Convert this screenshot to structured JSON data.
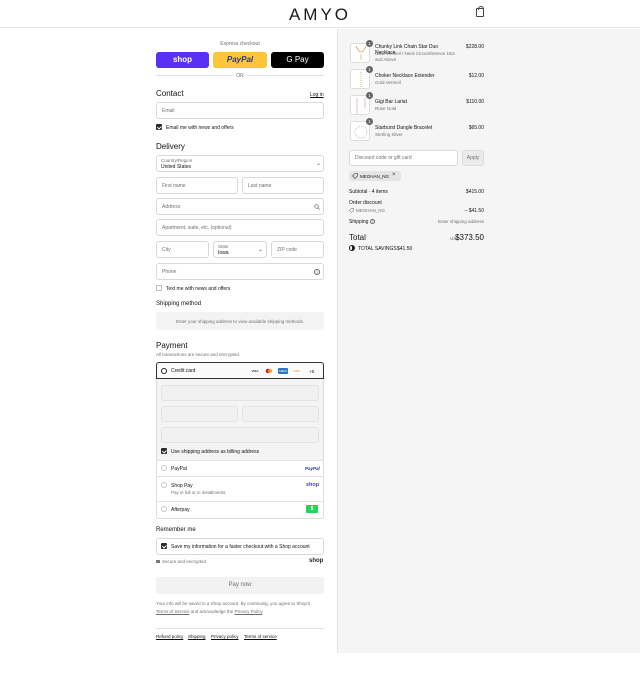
{
  "header": {
    "brand": "AMYO",
    "cart_icon": "shopping-bag-icon"
  },
  "express": {
    "heading": "Express checkout",
    "shop_label": "shop",
    "paypal_label": "PayPal",
    "gpay_label": "G Pay",
    "or_label": "OR",
    "colors": {
      "shop": "#5a31f4",
      "paypal": "#ffc439",
      "gpay": "#000000"
    }
  },
  "contact": {
    "title": "Contact",
    "login_link": "Log in",
    "email_placeholder": "Email",
    "newsletter_label": "Email me with news and offers"
  },
  "delivery": {
    "title": "Delivery",
    "country_label": "Country/Region",
    "country_value": "United States",
    "first_name_placeholder": "First name",
    "last_name_placeholder": "Last name",
    "address_placeholder": "Address",
    "apartment_placeholder": "Apartment, suite, etc. (optional)",
    "city_placeholder": "City",
    "state_label": "State",
    "state_value": "Iowa",
    "zip_placeholder": "ZIP code",
    "phone_placeholder": "Phone",
    "text_offers_label": "Text me with news and offers"
  },
  "shipping_method": {
    "title": "Shipping method",
    "notice": "Enter your shipping address to view available shipping methods."
  },
  "payment": {
    "title": "Payment",
    "subtitle": "All transactions are secure and encrypted.",
    "credit_card_label": "Credit card",
    "card_badges": [
      "VISA",
      "MC",
      "AMEX",
      "DISC"
    ],
    "more_cards": "+5",
    "billing_label": "Use shipping address as billing address",
    "paypal_label": "PayPal",
    "paypal_logo": "PayPal",
    "shoppay_label": "Shop Pay",
    "shoppay_sub": "Pay in full or in installments",
    "shoppay_logo": "shop",
    "afterpay_label": "Afterpay",
    "afterpay_logo": "$"
  },
  "remember": {
    "title": "Remember me",
    "save_label": "Save my information for a faster checkout with a Shop account",
    "secure_label": "Secure and encrypted",
    "shop_logo": "shop"
  },
  "pay_now": "Pay now",
  "legal": {
    "line1": "Your info will be saved to a Shop account. By continuing, you agree to Shop's",
    "tos": "Terms of Service",
    "and": "and acknowledge the",
    "privacy": "Privacy Policy",
    "period": "."
  },
  "footer_links": [
    "Refund policy",
    "Shipping",
    "Privacy policy",
    "Terms of service"
  ],
  "order": {
    "items": [
      {
        "qty": "1",
        "name": "Chunky Link Chain Star Duo Necklace",
        "variant": "Gold Vermeil / Neck Circumference 15in and Above",
        "price": "$228.00"
      },
      {
        "qty": "1",
        "name": "Choker Necklace Extender",
        "variant": "Gold Vermeil",
        "price": "$12.00"
      },
      {
        "qty": "1",
        "name": "Gigi Bar Lariat",
        "variant": "Rose Gold",
        "price": "$110.00"
      },
      {
        "qty": "1",
        "name": "Starburst Dangle Bracelet",
        "variant": "Sterling Silver",
        "price": "$65.00"
      }
    ],
    "discount_placeholder": "Discount code or gift card",
    "apply_label": "Apply",
    "code_chip": "MEGHAN_NG",
    "subtotal_label": "Subtotal · 4 items",
    "subtotal_value": "$415.00",
    "order_discount_label": "Order discount",
    "discount_code": "MEGHAN_NG",
    "discount_value": "– $41.50",
    "shipping_label": "Shipping",
    "shipping_value": "Enter shipping address",
    "total_label": "Total",
    "currency": "USD",
    "total_value": "$373.50",
    "savings_label": "TOTAL SAVINGS",
    "savings_value": "$41.50"
  }
}
